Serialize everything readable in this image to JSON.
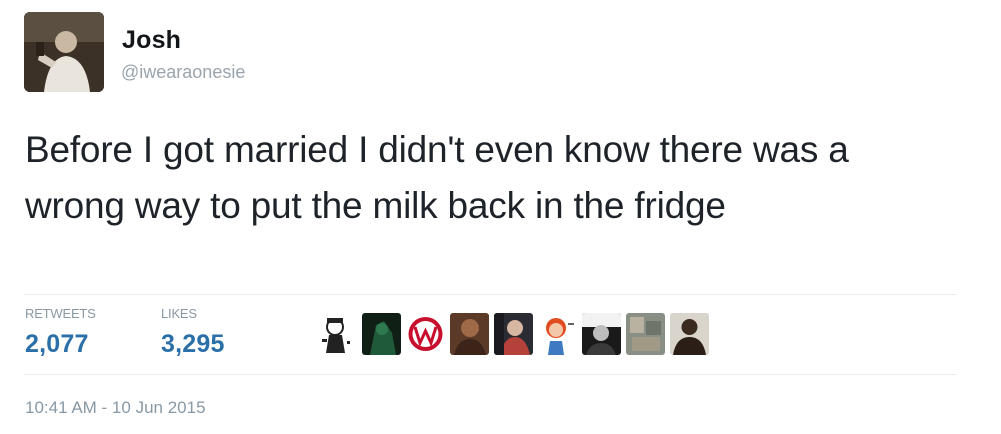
{
  "author": {
    "name": "Josh",
    "handle": "@iwearaonesie"
  },
  "tweet": {
    "text": "Before I got married I didn't even know there was a wrong way to put the milk back in the fridge"
  },
  "stats": {
    "retweets_label": "RETWEETS",
    "retweets_value": "2,077",
    "likes_label": "LIKES",
    "likes_value": "3,295"
  },
  "likers": [
    {
      "icon": "cartoon-character-avatar"
    },
    {
      "icon": "green-dark-avatar"
    },
    {
      "icon": "red-w-logo-avatar"
    },
    {
      "icon": "brown-photo-avatar"
    },
    {
      "icon": "person-photo-avatar"
    },
    {
      "icon": "cartoon-redhead-avatar"
    },
    {
      "icon": "black-white-photo-avatar"
    },
    {
      "icon": "grey-photo-avatar"
    },
    {
      "icon": "dark-figure-avatar"
    }
  ],
  "timestamp": "10:41 AM - 10 Jun 2015",
  "colors": {
    "stat_value": "#2b6fa8",
    "muted_text": "#8899a6",
    "tweet_text": "#1d2329"
  }
}
